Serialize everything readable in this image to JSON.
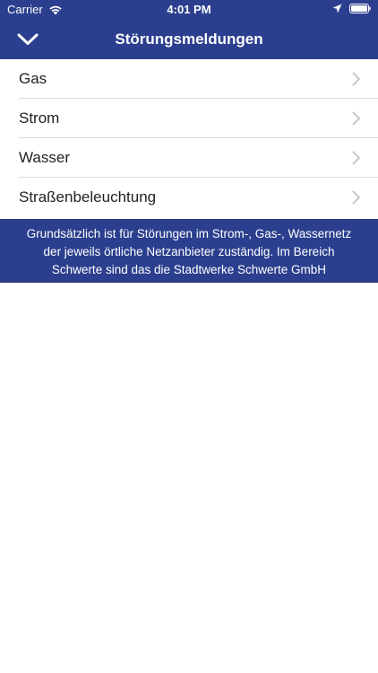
{
  "status_bar": {
    "carrier": "Carrier",
    "time": "4:01 PM",
    "icons": [
      "wifi-icon",
      "location-icon",
      "battery-icon"
    ]
  },
  "nav": {
    "title": "Störungsmeldungen",
    "back_icon": "chevron-down-icon"
  },
  "menu": {
    "items": [
      {
        "label": "Gas"
      },
      {
        "label": "Strom"
      },
      {
        "label": "Wasser"
      },
      {
        "label": "Straßenbeleuchtung"
      }
    ]
  },
  "info": {
    "lines": [
      "Grundsätzlich ist für Störungen im Strom-, Gas-, Wassernetz",
      "der jeweils örtliche Netzanbieter zuständig. Im Bereich",
      "Schwerte sind das die Stadtwerke Schwerte GmbH"
    ]
  },
  "colors": {
    "primary": "#2b3f8e",
    "background": "#ffffff",
    "separator": "#dcdcdc",
    "chevron": "#c7c7cc"
  }
}
